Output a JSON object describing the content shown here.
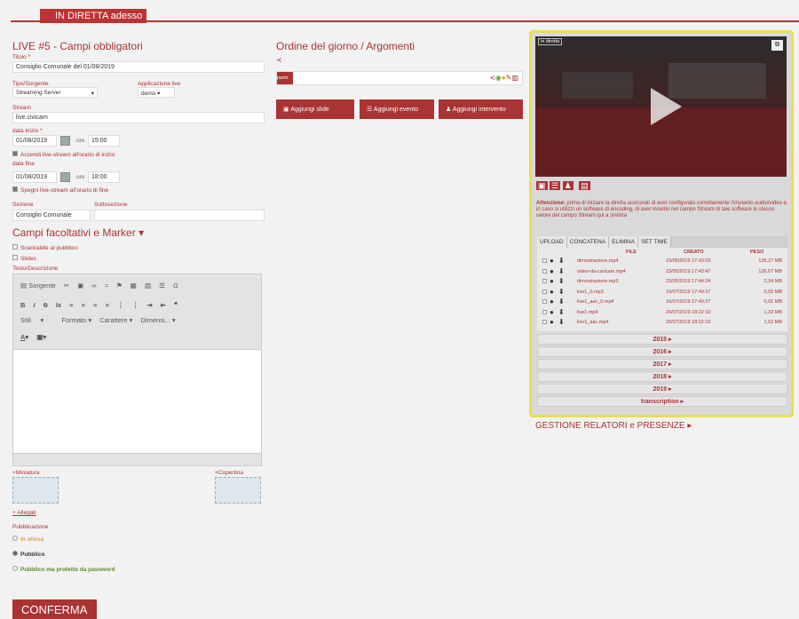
{
  "header": {
    "tab": "IN DIRETTA adesso"
  },
  "form": {
    "title": "LIVE #5 - Campi obbligatori",
    "titolo_label": "Titolo *",
    "titolo_value": "Consiglio Comunale del 01/08/2019",
    "tipo_label": "Tipo/Sorgente",
    "tipo_value": "Streaming Server",
    "app_label": "Applicazione live",
    "app_value": "demo",
    "stream_label": "Stream",
    "stream_value": "live.civicam",
    "data_inizio_label": "data inizio *",
    "data_inizio": "01/08/2019",
    "ore_label": "ore",
    "ora_inizio": "15:00",
    "accendi": "Accendi live-stream all'orario di inizio",
    "data_fine_label": "data fine",
    "data_fine": "01/08/2019",
    "ora_fine": "18:00",
    "spegni": "Spegni live-stream all'orario di fine",
    "sezione_label": "Sezione",
    "sezione_value": "Consiglio Comunale",
    "sottosezione_label": "Sottosezione",
    "optional_title": "Campi facoltativi e Marker",
    "scaricabile": "Scaricabile al pubblico",
    "slides": "Slides",
    "testo_label": "Testo/Descrizione",
    "editor": {
      "sorgente": "Sorgente",
      "stili": "Stili",
      "formato": "Formato",
      "carattere": "Carattere",
      "dimensione": "Dimensi..."
    },
    "miniatura": "+Miniatura",
    "copertina": "+Copertina",
    "allegati": "+ Allegati",
    "pubblicazione_label": "Pubblicazione",
    "in_attesa": "In attesa",
    "pubblico": "Pubblico",
    "protetto": "Pubblico ma protetto da password",
    "conferma": "CONFERMA"
  },
  "agenda": {
    "title": "Ordine del giorno / Argomenti",
    "row_label": "punto",
    "btn_slide": "Aggiungi slide",
    "btn_evento": "Aggiungi evento",
    "btn_intervento": "Aggiungi intervento"
  },
  "live": {
    "badge": "in diretta",
    "warning_bold": "Attenzione:",
    "warning_text": "prima di iniziare la diretta assicurati di aver configurato correttamente l'impianto audio/video e, in caso si utilizzi un software di encoding, di aver inserito nel campo Stream di tale software lo stesso valore del campo Stream qui a sinistra",
    "tabs": [
      "UPLOAD",
      "CONCATENA",
      "ELIMINA",
      "SET TIME"
    ],
    "col_file": "FILE",
    "col_creato": "CREATO",
    "col_peso": "PESO",
    "files": [
      {
        "name": "dimostrazione.mp4",
        "date": "23/05/2019 17:43:03",
        "size": "135,27 MB"
      },
      {
        "name": "video-da-caricare.mp4",
        "date": "23/05/2019 17:43:47",
        "size": "126,07 MB"
      },
      {
        "name": "dimostrazione.mp3",
        "date": "23/05/2019 17:44:24",
        "size": "2,34 MB"
      },
      {
        "name": "live1_0.mp3",
        "date": "16/07/2019 17:49:27",
        "size": "0,02 MB"
      },
      {
        "name": "live1_aac_0.mp4",
        "date": "16/07/2019 17:49:27",
        "size": "0,01 MB"
      },
      {
        "name": "live1.mp4",
        "date": "29/07/2019 18:22:10",
        "size": "1,22 MB"
      },
      {
        "name": "live1_aac.mp4",
        "date": "29/07/2019 18:22:10",
        "size": "1,02 MB"
      }
    ],
    "years": [
      "2015",
      "2016",
      "2017",
      "2018",
      "2019",
      "transcription"
    ],
    "relatori": "GESTIONE RELATORI e PRESENZE"
  }
}
